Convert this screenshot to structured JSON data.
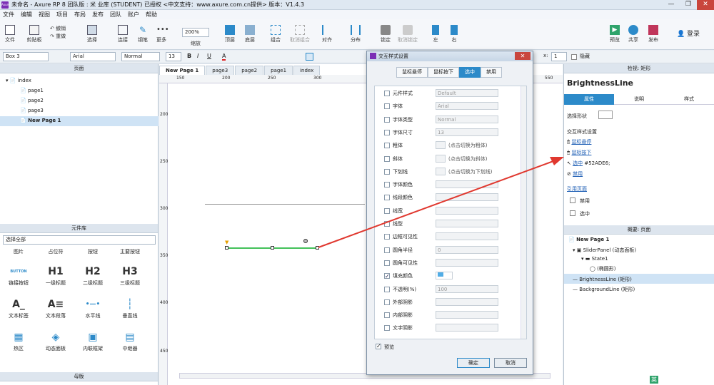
{
  "window": {
    "title": "未命名 - Axure RP 8 团队版 : 米 业库 (STUDENT) 已授权    <中文支持：www.axure.com.cn提供> 版本：V1.4.3",
    "app_icon": "Axure",
    "controls": [
      "—",
      "❐",
      "✕"
    ]
  },
  "menu": [
    "文件",
    "编辑",
    "视图",
    "项目",
    "布局",
    "发布",
    "团队",
    "账户",
    "帮助"
  ],
  "toolbar": {
    "file": "文件",
    "clipboard": "剪贴板",
    "undo": "撤销",
    "redo": "重做",
    "select": "选择",
    "connect": "连接",
    "pen": "钢笔",
    "more": "更多",
    "zoom_value": "200%",
    "zoom_label": "缩放",
    "top": "顶层",
    "bottom": "底层",
    "group": "组合",
    "ungroup": "取消组合",
    "align": "对齐",
    "distribute": "分布",
    "lock": "锁定",
    "unlock": "取消锁定",
    "left": "左",
    "right": "右",
    "preview": "预览",
    "share": "共享",
    "publish": "发布",
    "login": "登录"
  },
  "format": {
    "widget": "Box 3",
    "font": "Arial",
    "style": "Normal",
    "size": "13",
    "bold": "B",
    "italic": "I",
    "underline": "U",
    "x_label": "x:",
    "x_value": "1",
    "hidden": "隐藏"
  },
  "pages_panel": {
    "title": "页面",
    "root": "index",
    "pages": [
      "page1",
      "page2",
      "page3",
      "New Page 1"
    ]
  },
  "library": {
    "title": "元件库",
    "select": "选择全部",
    "categories": [
      "图片",
      "占位符",
      "按钮",
      "主要按钮"
    ],
    "items": [
      {
        "glyph": "BUTTON",
        "label": "链接按钮"
      },
      {
        "glyph": "H1",
        "label": "一级标题"
      },
      {
        "glyph": "H2",
        "label": "二级标题"
      },
      {
        "glyph": "H3",
        "label": "三级标题"
      },
      {
        "glyph": "A_",
        "label": "文本标签"
      },
      {
        "glyph": "A≡",
        "label": "文本段落"
      },
      {
        "glyph": "•—•",
        "label": "水平线"
      },
      {
        "glyph": "┆",
        "label": "垂直线"
      },
      {
        "glyph": "▦",
        "label": "热区"
      },
      {
        "glyph": "◈",
        "label": "动态面板"
      },
      {
        "glyph": "▣",
        "label": "内联框架"
      },
      {
        "glyph": "▤",
        "label": "中继器"
      }
    ],
    "masters": "母版"
  },
  "tabs": [
    "New Page 1",
    "page3",
    "page2",
    "page1",
    "index"
  ],
  "ruler": {
    "h": [
      "150",
      "200",
      "250",
      "300",
      "550"
    ],
    "v": [
      "200",
      "250",
      "300",
      "350",
      "400",
      "450"
    ]
  },
  "dialog": {
    "title": "交互样式设置",
    "tabs": [
      "鼠标悬停",
      "鼠标按下",
      "选中",
      "禁用"
    ],
    "rows": [
      {
        "label": "元件样式",
        "value": "Default",
        "checked": false
      },
      {
        "label": "字体",
        "value": "Arial",
        "checked": false
      },
      {
        "label": "字体类型",
        "value": "Normal",
        "checked": false
      },
      {
        "label": "字体尺寸",
        "value": "13",
        "checked": false
      },
      {
        "label": "粗体",
        "value": "(点击切换为粗体)",
        "checked": false
      },
      {
        "label": "斜体",
        "value": "(点击切换为斜体)",
        "checked": false
      },
      {
        "label": "下划线",
        "value": "(点击切换为下划线)",
        "checked": false
      },
      {
        "label": "字体颜色",
        "value": "",
        "checked": false
      },
      {
        "label": "线段颜色",
        "value": "",
        "checked": false
      },
      {
        "label": "线宽",
        "value": "",
        "checked": false
      },
      {
        "label": "线型",
        "value": "",
        "checked": false
      },
      {
        "label": "边框可见性",
        "value": "",
        "checked": false
      },
      {
        "label": "圆角半径",
        "value": "0",
        "checked": false
      },
      {
        "label": "圆角可见性",
        "value": "",
        "checked": false
      },
      {
        "label": "填充颜色",
        "value": "",
        "checked": true
      },
      {
        "label": "不透明(%)",
        "value": "100",
        "checked": false
      },
      {
        "label": "外部阴影",
        "value": "",
        "checked": false
      },
      {
        "label": "内部阴影",
        "value": "",
        "checked": false
      },
      {
        "label": "文字阴影",
        "value": "",
        "checked": false
      }
    ],
    "preview": "预览",
    "ok": "确定",
    "cancel": "取消"
  },
  "inspector": {
    "header": "检视: 矩形",
    "name": "BrightnessLine",
    "tabs": [
      "属性",
      "说明",
      "样式"
    ],
    "shape_label": "选择形状",
    "interaction_title": "交互样式设置",
    "links": [
      "鼠标悬停",
      "鼠标按下",
      "选中",
      "禁用"
    ],
    "selected_value": "#52ADE6;",
    "ref_page": "引用页面",
    "options": [
      "禁用",
      "选中"
    ]
  },
  "outline": {
    "title": "概要: 页面",
    "items": [
      "New Page 1",
      "SliderPanel (动态面板)",
      "State1",
      "(椭圆形)",
      "BrightnessLine (矩形)",
      "BackgroundLine (矩形)"
    ]
  },
  "tray": {
    "ime": "英"
  },
  "colors": {
    "accent": "#2c8ac9",
    "arrow": "#e0382f",
    "fill_swatch": "#52ADE6",
    "line_green": "#43c15a"
  }
}
